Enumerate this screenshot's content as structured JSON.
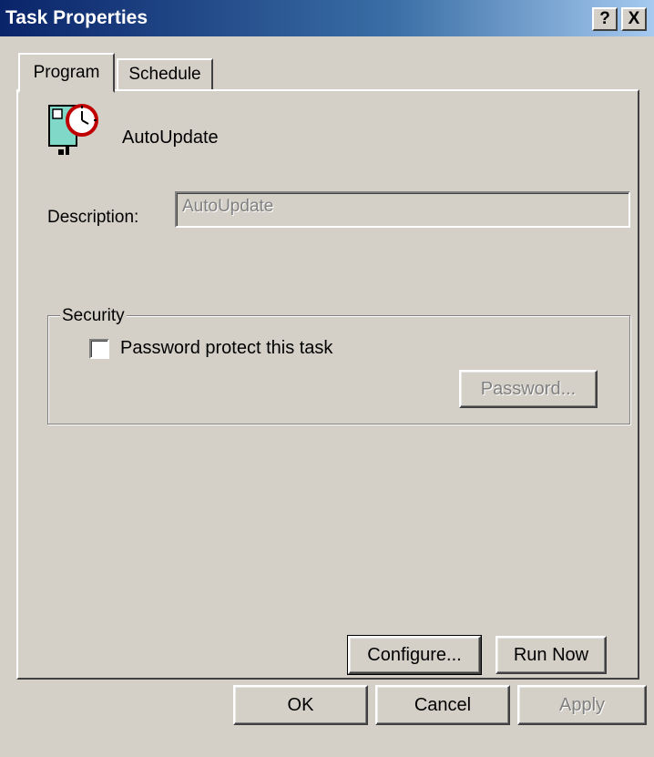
{
  "window": {
    "title": "Task Properties",
    "help_button": "?",
    "close_button": "X"
  },
  "tabs": [
    {
      "label": "Program",
      "active": true
    },
    {
      "label": "Schedule",
      "active": false
    }
  ],
  "program": {
    "task_name": "AutoUpdate",
    "icon": "scheduled-task-icon",
    "description_label": "Description:",
    "description_value": "AutoUpdate"
  },
  "security": {
    "group_label": "Security",
    "checkbox_label": "Password protect this task",
    "checkbox_checked": false,
    "password_button": "Password..."
  },
  "panel_buttons": {
    "configure": "Configure...",
    "run_now": "Run Now"
  },
  "dialog_buttons": {
    "ok": "OK",
    "cancel": "Cancel",
    "apply": "Apply"
  },
  "colors": {
    "titlebar_start": "#0a246a",
    "titlebar_end": "#a6caf0",
    "face": "#d4d0c8"
  }
}
